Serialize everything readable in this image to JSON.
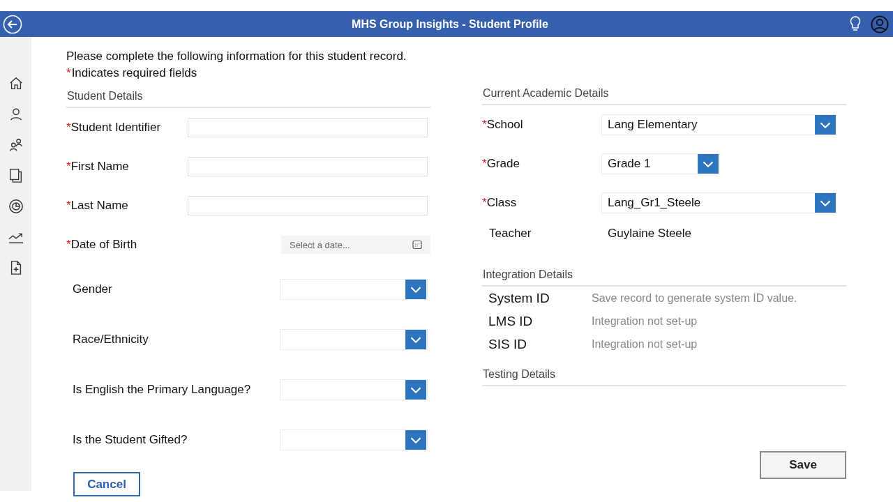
{
  "header": {
    "title": "MHS Group Insights - Student Profile"
  },
  "sidebar": {
    "items": [
      {
        "kind": "home"
      },
      {
        "kind": "person"
      },
      {
        "kind": "people"
      },
      {
        "kind": "pages"
      },
      {
        "kind": "chart"
      },
      {
        "kind": "trend"
      },
      {
        "kind": "add-file"
      }
    ]
  },
  "intro": "Please complete the following information for this student record.",
  "required_mark": "*",
  "required_note": "Indicates required fields",
  "student_details": {
    "title": "Student Details",
    "fields": [
      {
        "label": "Student Identifier",
        "required": true,
        "kind": "text"
      },
      {
        "label": "First Name",
        "required": true,
        "kind": "text"
      },
      {
        "label": "Last Name",
        "required": true,
        "kind": "text"
      },
      {
        "label": "Date of Birth",
        "required": true,
        "kind": "date",
        "placeholder": "Select a date..."
      },
      {
        "label": "Gender",
        "required": false,
        "kind": "dropdown"
      },
      {
        "label": "Race/Ethnicity",
        "required": false,
        "kind": "dropdown"
      },
      {
        "label": "Is English the Primary Language?",
        "required": false,
        "kind": "dropdown"
      },
      {
        "label": "Is the Student Gifted?",
        "required": false,
        "kind": "dropdown"
      }
    ]
  },
  "academic_details": {
    "title": "Current Academic Details",
    "fields": [
      {
        "label": "School",
        "required": true,
        "kind": "dropdown",
        "wide": true,
        "value": "Lang Elementary"
      },
      {
        "label": "Grade",
        "required": true,
        "kind": "dropdown",
        "wide": false,
        "value": "Grade 1"
      },
      {
        "label": "Class",
        "required": true,
        "kind": "dropdown",
        "wide": true,
        "value": "Lang_Gr1_Steele"
      },
      {
        "label": "Teacher",
        "required": false,
        "kind": "static",
        "value": "Guylaine Steele"
      }
    ]
  },
  "integration_details": {
    "title": "Integration Details",
    "rows": [
      {
        "label": "System ID",
        "value": "Save record to generate system ID value."
      },
      {
        "label": "LMS ID",
        "value": "Integration not set-up"
      },
      {
        "label": "SIS ID",
        "value": "Integration not set-up"
      }
    ]
  },
  "testing_details": {
    "title": "Testing Details"
  },
  "buttons": {
    "cancel": "Cancel",
    "save": "Save"
  }
}
